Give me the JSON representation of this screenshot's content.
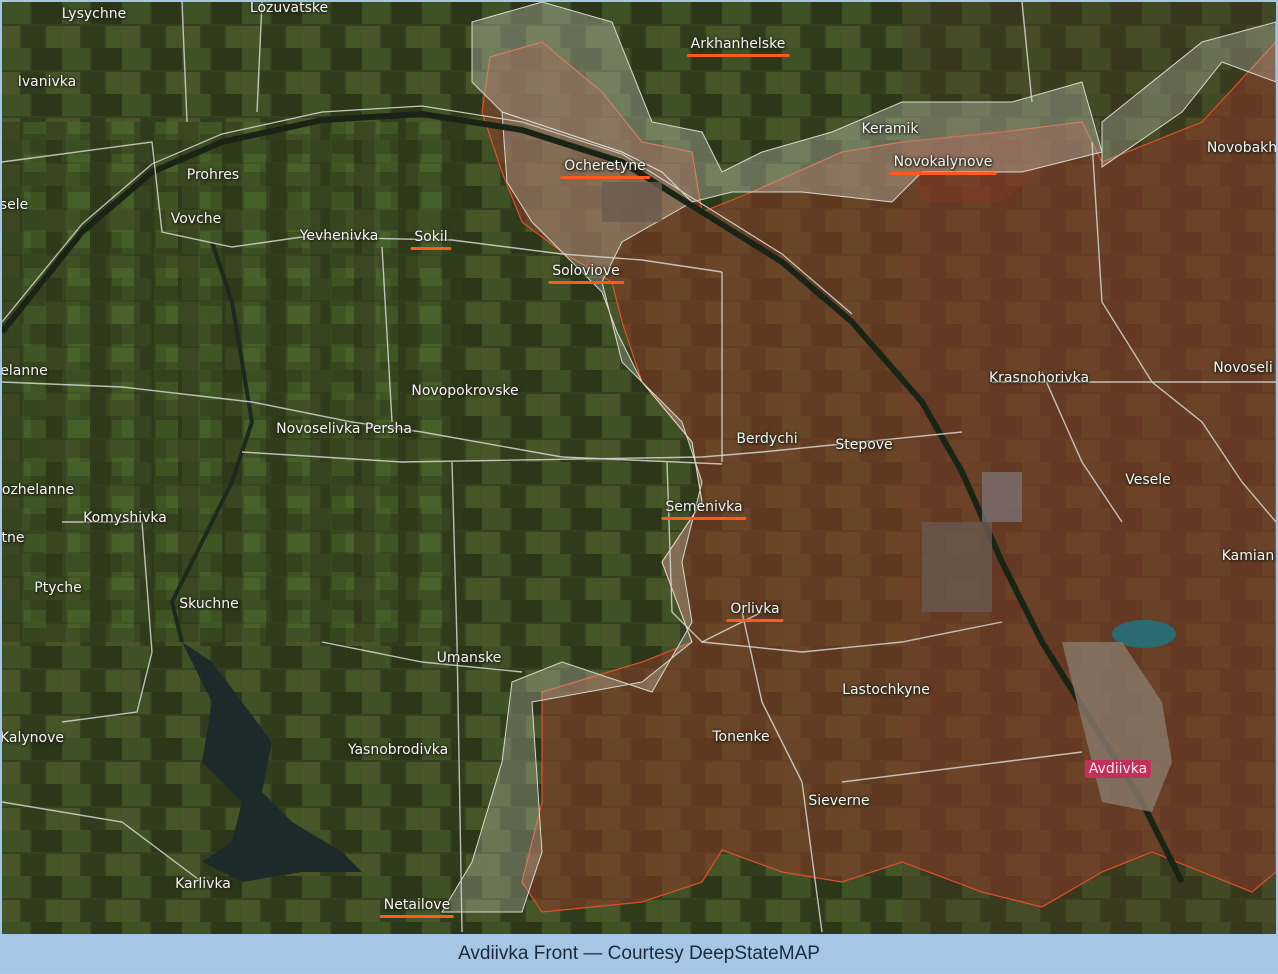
{
  "caption": "Avdiivka Front — Courtesy DeepStateMAP",
  "colors": {
    "frame": "#a6c6e6",
    "field_dark": "#2f3a22",
    "field_green": "#3d5a2a",
    "occupied_fill": "#8a3a28",
    "occupied_border": "#e0502a",
    "grey_zone_fill": "#b8bcb0",
    "highlight_underline": "#ff5a1e",
    "city_badge": "#c2305a",
    "road": "#d8d8d8",
    "water": "#1d2a2a"
  },
  "places": {
    "lysychne": "Lysychne",
    "lozuvatske": "Lozuvatske",
    "arkhanhelske": "Arkhanhelske",
    "ivanivka": "Ivanivka",
    "keramik": "Keramik",
    "novobakh": "Novobakh",
    "prohres": "Prohres",
    "ocheretyne": "Ocheretyne",
    "novokalynove": "Novokalynove",
    "sele": "sele",
    "vovche": "Vovche",
    "yevhenivka": "Yevhenivka",
    "sokil": "Sokil",
    "solovіove": "Solovіove",
    "elanne": "elanne",
    "novopokrovske": "Novopokrovske",
    "krasnohorivka": "Krasnohorivka",
    "novoseli": "Novoseli",
    "novoselivka_persha": "Novoselivka Persha",
    "berdychi": "Berdychi",
    "stepove": "Stepove",
    "ozhelanne": "ozhelanne",
    "vesele": "Vesele",
    "komyshivka": "Komyshivka",
    "semenivka": "Semenivka",
    "tne": "tne",
    "kamian": "Kamian",
    "ptyche": "Ptyche",
    "skuchne": "Skuchne",
    "orlivka": "Orlivka",
    "umanske": "Umanske",
    "lastochkyne": "Lastochkyne",
    "kalynove": "Kalynove",
    "tonenke": "Tonenke",
    "yasnobrodivka": "Yasnobrodivka",
    "avdiivka": "Avdiivka",
    "sieverne": "Sieverne",
    "karlivka": "Karlivka",
    "netailove": "Netailove"
  }
}
